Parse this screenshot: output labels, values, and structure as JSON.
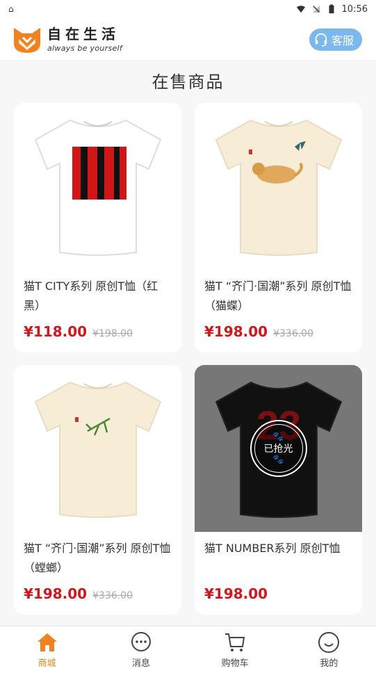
{
  "status": {
    "time": "10:56"
  },
  "header": {
    "brand_name": "自在生活",
    "slogan": "always be yourself",
    "service_label": "客服",
    "accent": "#7cb8f0"
  },
  "section_title": "在售商品",
  "products": [
    {
      "title": "猫T CITY系列 原创T恤（红黑）",
      "price": "¥118.00",
      "old_price": "¥198.00",
      "shirt_color": "#ffffff",
      "sold_out": false
    },
    {
      "title": "猫T “齐门·国潮”系列 原创T恤（猫蝶）",
      "price": "¥198.00",
      "old_price": "¥336.00",
      "shirt_color": "#f7ecd6",
      "sold_out": false
    },
    {
      "title": "猫T “齐门·国潮”系列 原创T恤（螳螂）",
      "price": "¥198.00",
      "old_price": "¥336.00",
      "shirt_color": "#f7ecd6",
      "sold_out": false
    },
    {
      "title": "猫T NUMBER系列 原创T恤",
      "price": "¥198.00",
      "old_price": "",
      "shirt_color": "#111111",
      "sold_out": true,
      "sold_out_label": "已抢光",
      "print_text": "23"
    }
  ],
  "tabs": [
    {
      "label": "商城",
      "icon": "home-icon",
      "active": true
    },
    {
      "label": "消息",
      "icon": "message-icon",
      "active": false
    },
    {
      "label": "购物车",
      "icon": "cart-icon",
      "active": false
    },
    {
      "label": "我的",
      "icon": "smile-icon",
      "active": false
    }
  ],
  "colors": {
    "price": "#d6151b",
    "active_tab": "#f08320",
    "logo": "#f08320"
  }
}
